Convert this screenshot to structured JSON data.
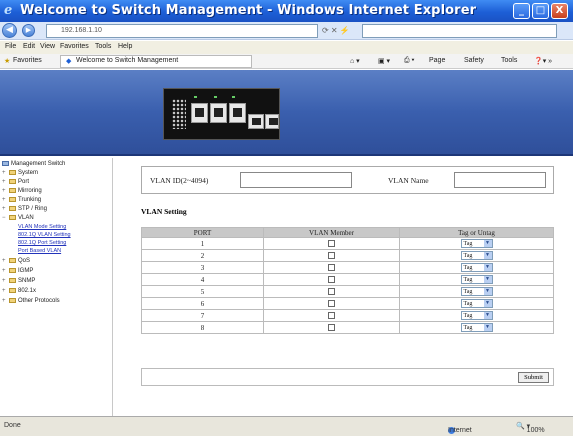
{
  "window": {
    "title": "Welcome to Switch Management - Windows Internet Explorer",
    "minimize_glyph": "_",
    "restore_glyph": "□",
    "close_glyph": "X"
  },
  "addressbar": {
    "back_icon": "back-arrow-icon",
    "forward_icon": "forward-arrow-icon",
    "url": "192.168.1.10"
  },
  "menubar": {
    "items": [
      "File",
      "Edit",
      "View",
      "Favorites",
      "Tools",
      "Help"
    ]
  },
  "favbar": {
    "favorites_label": "Favorites",
    "tab_label": "Welcome to Switch Management",
    "page_label": "Page",
    "safety_label": "Safety",
    "tools_label": "Tools"
  },
  "sidebar": {
    "root": "Management Switch",
    "items": [
      "System",
      "Port",
      "Mirroring",
      "Trunking",
      "STP / Ring",
      "VLAN",
      "QoS",
      "IGMP",
      "SNMP",
      "802.1x",
      "Other Protocols"
    ],
    "vlan_links": [
      "VLAN Mode Setting",
      "802.1Q VLAN Setting",
      "802.1Q Port Setting",
      "Port Based VLAN"
    ]
  },
  "main": {
    "vid_label": "VLAN ID(2~4094)",
    "vid_value": "",
    "vname_label": "VLAN Name",
    "vname_value": "",
    "section_title": "VLAN Setting",
    "headers": [
      "PORT",
      "VLAN Member",
      "Tag or Untag"
    ],
    "rows": [
      {
        "port": "1",
        "tag": "Tag"
      },
      {
        "port": "2",
        "tag": "Tag"
      },
      {
        "port": "3",
        "tag": "Tag"
      },
      {
        "port": "4",
        "tag": "Tag"
      },
      {
        "port": "5",
        "tag": "Tag"
      },
      {
        "port": "6",
        "tag": "Tag"
      },
      {
        "port": "7",
        "tag": "Tag"
      },
      {
        "port": "8",
        "tag": "Tag"
      }
    ],
    "submit_label": "Submit"
  },
  "statusbar": {
    "left_text": "Done",
    "zone": "Internet",
    "zoom": "100%"
  },
  "colors": {
    "titlebar": "#1d5fd6",
    "banner": "#3a5fae",
    "table_header": "#c8c8c8",
    "link": "#2233bb"
  }
}
